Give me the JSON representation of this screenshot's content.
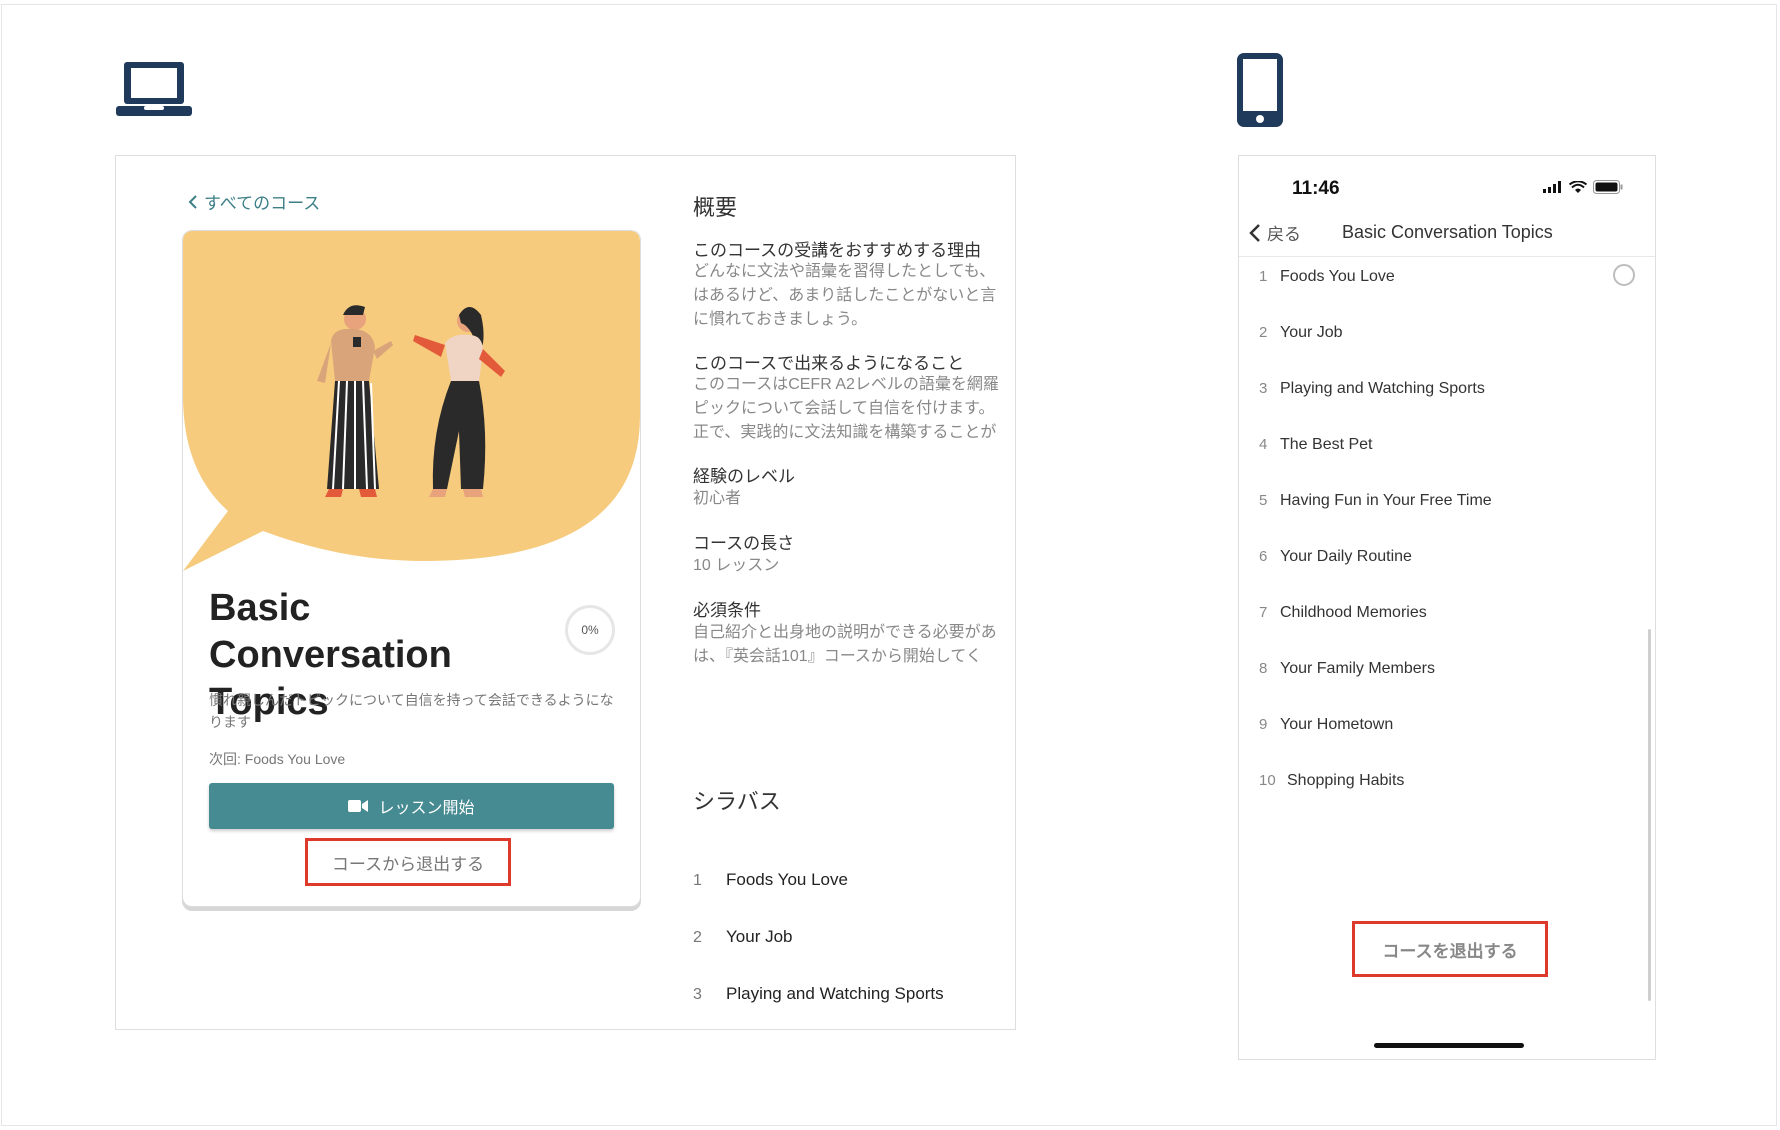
{
  "desktop": {
    "back_link": "すべてのコース",
    "course_title": "Basic Conversation Topics",
    "progress": "0%",
    "progress_value": 0,
    "description": "慣れ親しんだトピックについて自信を持って会話できるようになります",
    "next_lesson": "次回: Foods You Love",
    "start_button": "レッスン開始",
    "leave_button": "コースから退出する",
    "overview_heading": "概要",
    "sections": [
      {
        "heading": "このコースの受講をおすすめする理由",
        "lines": [
          "どんなに文法や語彙を習得したとしても、",
          "はあるけど、あまり話したことがないと言",
          "に慣れておきましょう。"
        ]
      },
      {
        "heading": "このコースで出来るようになること",
        "lines": [
          "このコースはCEFR A2レベルの語彙を網羅",
          "ピックについて会話して自信を付けます。",
          "正で、実践的に文法知識を構築することが"
        ]
      },
      {
        "heading": "経験のレベル",
        "lines": [
          "初心者"
        ]
      },
      {
        "heading": "コースの長さ",
        "lines": [
          "10 レッスン"
        ]
      },
      {
        "heading": "必須条件",
        "lines": [
          "自己紹介と出身地の説明ができる必要があ",
          "は、『英会話101』コースから開始してく"
        ]
      }
    ],
    "syllabus_heading": "シラバス",
    "syllabus": [
      {
        "num": "1",
        "title": "Foods You Love"
      },
      {
        "num": "2",
        "title": "Your Job"
      },
      {
        "num": "3",
        "title": "Playing and Watching Sports"
      }
    ]
  },
  "mobile": {
    "time": "11:46",
    "back": "戻る",
    "title": "Basic Conversation Topics",
    "lessons": [
      {
        "num": "1",
        "title": "Foods You Love"
      },
      {
        "num": "2",
        "title": "Your Job"
      },
      {
        "num": "3",
        "title": "Playing and Watching Sports"
      },
      {
        "num": "4",
        "title": "The Best Pet"
      },
      {
        "num": "5",
        "title": "Having Fun in Your Free Time"
      },
      {
        "num": "6",
        "title": "Your Daily Routine"
      },
      {
        "num": "7",
        "title": "Childhood Memories"
      },
      {
        "num": "8",
        "title": "Your Family Members"
      },
      {
        "num": "9",
        "title": "Your Hometown"
      },
      {
        "num": "10",
        "title": "Shopping Habits"
      }
    ],
    "leave_button": "コースを退出する"
  },
  "icons": {
    "desktop_device": "laptop-icon",
    "mobile_device": "smartphone-icon"
  },
  "colors": {
    "accent": "#468a92",
    "highlight": "#dd3a2c",
    "hero": "#f6cb7d",
    "device_icon": "#1f3a5a"
  }
}
